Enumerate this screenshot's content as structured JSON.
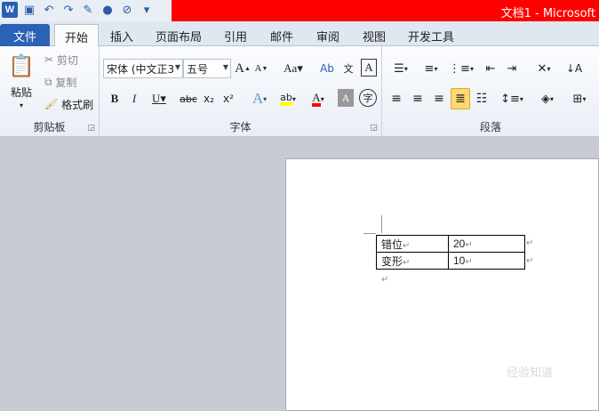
{
  "window": {
    "title": "文档1 - Microsoft"
  },
  "tabs": [
    {
      "label": "文件"
    },
    {
      "label": "开始"
    },
    {
      "label": "插入"
    },
    {
      "label": "页面布局"
    },
    {
      "label": "引用"
    },
    {
      "label": "邮件"
    },
    {
      "label": "审阅"
    },
    {
      "label": "视图"
    },
    {
      "label": "开发工具"
    }
  ],
  "clipboard": {
    "paste": "粘贴",
    "cut": "剪切",
    "copy": "复制",
    "format_painter": "格式刷",
    "group_label": "剪贴板"
  },
  "font": {
    "name": "宋体 (中文正3",
    "size": "五号",
    "grow": "A",
    "shrink": "A",
    "case": "Aa",
    "group_label": "字体",
    "bold": "B",
    "italic": "I",
    "underline": "U",
    "strike": "abc",
    "subscript": "x₂",
    "superscript": "x²"
  },
  "paragraph": {
    "group_label": "段落"
  },
  "table": {
    "rows": [
      {
        "label": "错位",
        "value": "20"
      },
      {
        "label": "变形",
        "value": "10"
      }
    ]
  },
  "marks": {
    "para": "↵"
  },
  "watermark": "经验知道"
}
